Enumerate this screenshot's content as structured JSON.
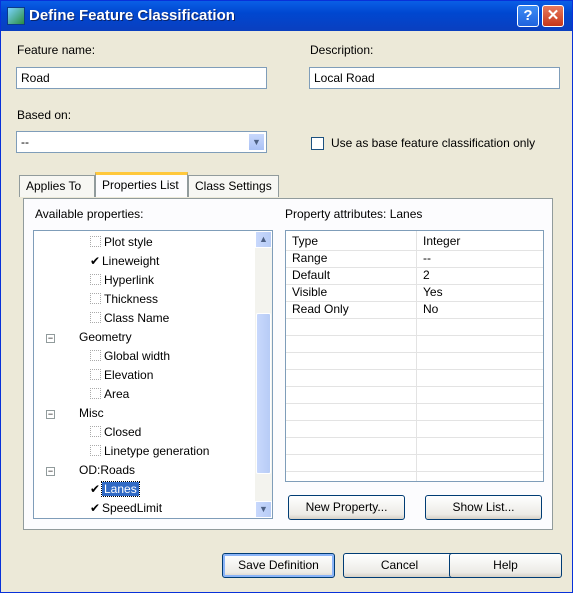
{
  "window": {
    "title": "Define Feature Classification",
    "help_glyph": "?",
    "close_glyph": "✕"
  },
  "form": {
    "feature_name_label": "Feature name:",
    "feature_name_value": "Road",
    "description_label": "Description:",
    "description_value": "Local Road",
    "based_on_label": "Based on:",
    "based_on_value": "--",
    "base_only_label": "Use as base feature classification only"
  },
  "tabs": [
    {
      "label": "Applies To"
    },
    {
      "label": "Properties List"
    },
    {
      "label": "Class Settings"
    }
  ],
  "properties": {
    "available_label": "Available properties:",
    "tree": [
      {
        "label": "Plot style",
        "checked": false
      },
      {
        "label": "Lineweight",
        "checked": true
      },
      {
        "label": "Hyperlink",
        "checked": false
      },
      {
        "label": "Thickness",
        "checked": false
      },
      {
        "label": "Class Name",
        "checked": false
      },
      {
        "label": "Geometry",
        "group": true
      },
      {
        "label": "Global width",
        "checked": false
      },
      {
        "label": "Elevation",
        "checked": false
      },
      {
        "label": "Area",
        "checked": false
      },
      {
        "label": "Misc",
        "group": true
      },
      {
        "label": "Closed",
        "checked": false
      },
      {
        "label": "Linetype generation",
        "checked": false
      },
      {
        "label": "OD:Roads",
        "group": true
      },
      {
        "label": "Lanes",
        "checked": true,
        "selected": true
      },
      {
        "label": "SpeedLimit",
        "checked": true
      }
    ],
    "attributes_label": "Property attributes: Lanes",
    "attributes": [
      {
        "name": "Type",
        "value": "Integer"
      },
      {
        "name": "Range",
        "value": "--"
      },
      {
        "name": "Default",
        "value": "2"
      },
      {
        "name": "Visible",
        "value": "Yes"
      },
      {
        "name": "Read Only",
        "value": "No"
      }
    ],
    "new_property_label": "New Property...",
    "show_list_label": "Show List..."
  },
  "footer": {
    "save_label": "Save Definition",
    "cancel_label": "Cancel",
    "help_label": "Help"
  },
  "colors": {
    "titlebar": "#0047d0",
    "face": "#ece9d8",
    "selection": "#316ac5"
  }
}
